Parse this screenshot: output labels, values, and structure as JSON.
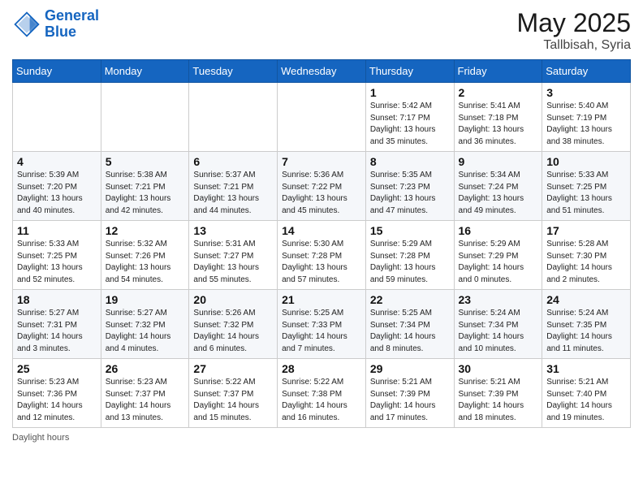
{
  "header": {
    "logo_line1": "General",
    "logo_line2": "Blue",
    "month_year": "May 2025",
    "location": "Tallbisah, Syria"
  },
  "weekdays": [
    "Sunday",
    "Monday",
    "Tuesday",
    "Wednesday",
    "Thursday",
    "Friday",
    "Saturday"
  ],
  "weeks": [
    [
      {
        "day": "",
        "sunrise": "",
        "sunset": "",
        "daylight": ""
      },
      {
        "day": "",
        "sunrise": "",
        "sunset": "",
        "daylight": ""
      },
      {
        "day": "",
        "sunrise": "",
        "sunset": "",
        "daylight": ""
      },
      {
        "day": "",
        "sunrise": "",
        "sunset": "",
        "daylight": ""
      },
      {
        "day": "1",
        "sunrise": "Sunrise: 5:42 AM",
        "sunset": "Sunset: 7:17 PM",
        "daylight": "Daylight: 13 hours and 35 minutes."
      },
      {
        "day": "2",
        "sunrise": "Sunrise: 5:41 AM",
        "sunset": "Sunset: 7:18 PM",
        "daylight": "Daylight: 13 hours and 36 minutes."
      },
      {
        "day": "3",
        "sunrise": "Sunrise: 5:40 AM",
        "sunset": "Sunset: 7:19 PM",
        "daylight": "Daylight: 13 hours and 38 minutes."
      }
    ],
    [
      {
        "day": "4",
        "sunrise": "Sunrise: 5:39 AM",
        "sunset": "Sunset: 7:20 PM",
        "daylight": "Daylight: 13 hours and 40 minutes."
      },
      {
        "day": "5",
        "sunrise": "Sunrise: 5:38 AM",
        "sunset": "Sunset: 7:21 PM",
        "daylight": "Daylight: 13 hours and 42 minutes."
      },
      {
        "day": "6",
        "sunrise": "Sunrise: 5:37 AM",
        "sunset": "Sunset: 7:21 PM",
        "daylight": "Daylight: 13 hours and 44 minutes."
      },
      {
        "day": "7",
        "sunrise": "Sunrise: 5:36 AM",
        "sunset": "Sunset: 7:22 PM",
        "daylight": "Daylight: 13 hours and 45 minutes."
      },
      {
        "day": "8",
        "sunrise": "Sunrise: 5:35 AM",
        "sunset": "Sunset: 7:23 PM",
        "daylight": "Daylight: 13 hours and 47 minutes."
      },
      {
        "day": "9",
        "sunrise": "Sunrise: 5:34 AM",
        "sunset": "Sunset: 7:24 PM",
        "daylight": "Daylight: 13 hours and 49 minutes."
      },
      {
        "day": "10",
        "sunrise": "Sunrise: 5:33 AM",
        "sunset": "Sunset: 7:25 PM",
        "daylight": "Daylight: 13 hours and 51 minutes."
      }
    ],
    [
      {
        "day": "11",
        "sunrise": "Sunrise: 5:33 AM",
        "sunset": "Sunset: 7:25 PM",
        "daylight": "Daylight: 13 hours and 52 minutes."
      },
      {
        "day": "12",
        "sunrise": "Sunrise: 5:32 AM",
        "sunset": "Sunset: 7:26 PM",
        "daylight": "Daylight: 13 hours and 54 minutes."
      },
      {
        "day": "13",
        "sunrise": "Sunrise: 5:31 AM",
        "sunset": "Sunset: 7:27 PM",
        "daylight": "Daylight: 13 hours and 55 minutes."
      },
      {
        "day": "14",
        "sunrise": "Sunrise: 5:30 AM",
        "sunset": "Sunset: 7:28 PM",
        "daylight": "Daylight: 13 hours and 57 minutes."
      },
      {
        "day": "15",
        "sunrise": "Sunrise: 5:29 AM",
        "sunset": "Sunset: 7:28 PM",
        "daylight": "Daylight: 13 hours and 59 minutes."
      },
      {
        "day": "16",
        "sunrise": "Sunrise: 5:29 AM",
        "sunset": "Sunset: 7:29 PM",
        "daylight": "Daylight: 14 hours and 0 minutes."
      },
      {
        "day": "17",
        "sunrise": "Sunrise: 5:28 AM",
        "sunset": "Sunset: 7:30 PM",
        "daylight": "Daylight: 14 hours and 2 minutes."
      }
    ],
    [
      {
        "day": "18",
        "sunrise": "Sunrise: 5:27 AM",
        "sunset": "Sunset: 7:31 PM",
        "daylight": "Daylight: 14 hours and 3 minutes."
      },
      {
        "day": "19",
        "sunrise": "Sunrise: 5:27 AM",
        "sunset": "Sunset: 7:32 PM",
        "daylight": "Daylight: 14 hours and 4 minutes."
      },
      {
        "day": "20",
        "sunrise": "Sunrise: 5:26 AM",
        "sunset": "Sunset: 7:32 PM",
        "daylight": "Daylight: 14 hours and 6 minutes."
      },
      {
        "day": "21",
        "sunrise": "Sunrise: 5:25 AM",
        "sunset": "Sunset: 7:33 PM",
        "daylight": "Daylight: 14 hours and 7 minutes."
      },
      {
        "day": "22",
        "sunrise": "Sunrise: 5:25 AM",
        "sunset": "Sunset: 7:34 PM",
        "daylight": "Daylight: 14 hours and 8 minutes."
      },
      {
        "day": "23",
        "sunrise": "Sunrise: 5:24 AM",
        "sunset": "Sunset: 7:34 PM",
        "daylight": "Daylight: 14 hours and 10 minutes."
      },
      {
        "day": "24",
        "sunrise": "Sunrise: 5:24 AM",
        "sunset": "Sunset: 7:35 PM",
        "daylight": "Daylight: 14 hours and 11 minutes."
      }
    ],
    [
      {
        "day": "25",
        "sunrise": "Sunrise: 5:23 AM",
        "sunset": "Sunset: 7:36 PM",
        "daylight": "Daylight: 14 hours and 12 minutes."
      },
      {
        "day": "26",
        "sunrise": "Sunrise: 5:23 AM",
        "sunset": "Sunset: 7:37 PM",
        "daylight": "Daylight: 14 hours and 13 minutes."
      },
      {
        "day": "27",
        "sunrise": "Sunrise: 5:22 AM",
        "sunset": "Sunset: 7:37 PM",
        "daylight": "Daylight: 14 hours and 15 minutes."
      },
      {
        "day": "28",
        "sunrise": "Sunrise: 5:22 AM",
        "sunset": "Sunset: 7:38 PM",
        "daylight": "Daylight: 14 hours and 16 minutes."
      },
      {
        "day": "29",
        "sunrise": "Sunrise: 5:21 AM",
        "sunset": "Sunset: 7:39 PM",
        "daylight": "Daylight: 14 hours and 17 minutes."
      },
      {
        "day": "30",
        "sunrise": "Sunrise: 5:21 AM",
        "sunset": "Sunset: 7:39 PM",
        "daylight": "Daylight: 14 hours and 18 minutes."
      },
      {
        "day": "31",
        "sunrise": "Sunrise: 5:21 AM",
        "sunset": "Sunset: 7:40 PM",
        "daylight": "Daylight: 14 hours and 19 minutes."
      }
    ]
  ],
  "footer": {
    "note": "Daylight hours"
  }
}
